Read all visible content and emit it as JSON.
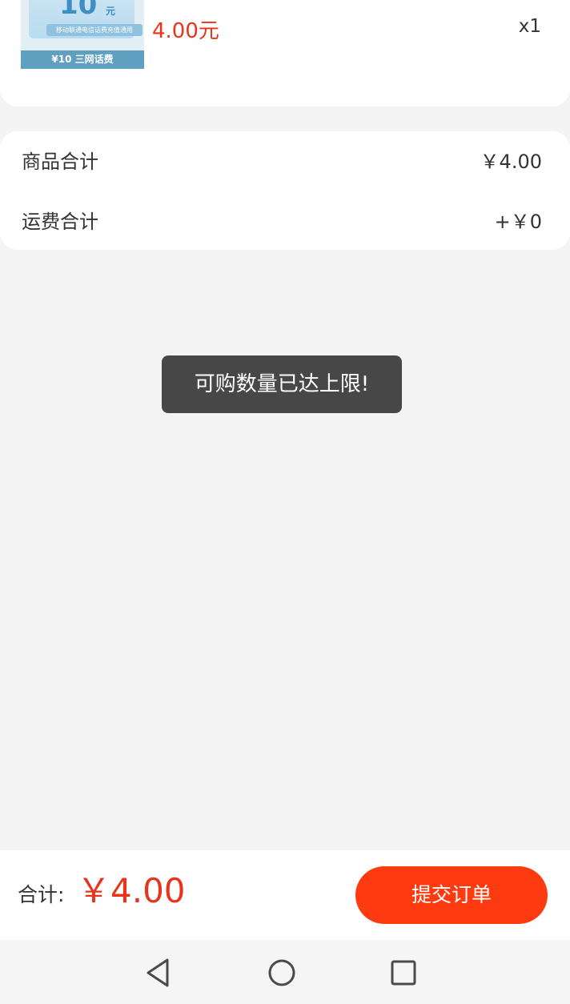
{
  "product": {
    "thumbnail": {
      "denomination": "10",
      "denomination_unit": "元",
      "strip_text": "移动联通电信话费充值通用",
      "band_text": "¥10 三网话费"
    },
    "price": "4.00元",
    "quantity": "x1"
  },
  "summary": {
    "rows": [
      {
        "label": "商品合计",
        "value": "￥4.00"
      },
      {
        "label": "运费合计",
        "value": "+￥0"
      }
    ]
  },
  "toast": {
    "message": "可购数量已达上限!"
  },
  "bottom_bar": {
    "total_label": "合计:",
    "total_value": "￥4.00",
    "submit_label": "提交订单"
  },
  "nav_bar": {
    "buttons": [
      "back-icon",
      "home-icon",
      "recents-icon"
    ]
  },
  "colors": {
    "accent_red": "#e8341c",
    "submit_orange": "#fe3b10",
    "toast_bg": "#474747",
    "page_bg": "#f4f4f4"
  }
}
